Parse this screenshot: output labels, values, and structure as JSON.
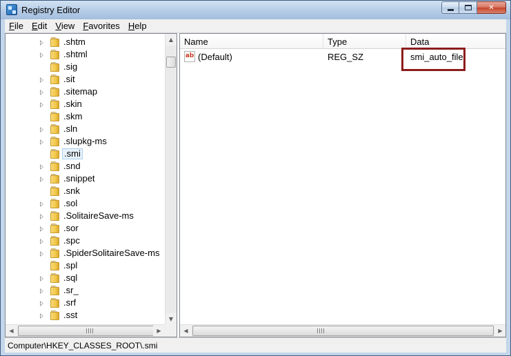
{
  "window": {
    "title": "Registry Editor"
  },
  "menubar": {
    "items": [
      {
        "first": "F",
        "rest": "ile"
      },
      {
        "first": "E",
        "rest": "dit"
      },
      {
        "first": "V",
        "rest": "iew"
      },
      {
        "first": "F",
        "rest": "avorites"
      },
      {
        "first": "H",
        "rest": "elp"
      }
    ]
  },
  "tree": {
    "items": [
      {
        "label": ".shtm",
        "expandable": true
      },
      {
        "label": ".shtml",
        "expandable": true
      },
      {
        "label": ".sig",
        "expandable": false
      },
      {
        "label": ".sit",
        "expandable": true
      },
      {
        "label": ".sitemap",
        "expandable": true
      },
      {
        "label": ".skin",
        "expandable": true
      },
      {
        "label": ".skm",
        "expandable": false
      },
      {
        "label": ".sln",
        "expandable": true
      },
      {
        "label": ".slupkg-ms",
        "expandable": true
      },
      {
        "label": ".smi",
        "expandable": false,
        "selected": true
      },
      {
        "label": ".snd",
        "expandable": true
      },
      {
        "label": ".snippet",
        "expandable": true
      },
      {
        "label": ".snk",
        "expandable": false
      },
      {
        "label": ".sol",
        "expandable": true
      },
      {
        "label": ".SolitaireSave-ms",
        "expandable": true
      },
      {
        "label": ".sor",
        "expandable": true
      },
      {
        "label": ".spc",
        "expandable": true
      },
      {
        "label": ".SpiderSolitaireSave-ms",
        "expandable": true
      },
      {
        "label": ".spl",
        "expandable": false
      },
      {
        "label": ".sql",
        "expandable": true
      },
      {
        "label": ".sr_",
        "expandable": true
      },
      {
        "label": ".srf",
        "expandable": true
      },
      {
        "label": ".sst",
        "expandable": true
      }
    ]
  },
  "list": {
    "columns": {
      "name": "Name",
      "type": "Type",
      "data": "Data"
    },
    "rows": [
      {
        "icon": "ab",
        "name": "(Default)",
        "type": "REG_SZ",
        "data": "smi_auto_file"
      }
    ]
  },
  "statusbar": {
    "path": "Computer\\HKEY_CLASSES_ROOT\\.smi"
  },
  "colors": {
    "highlight_box": "#8c1c1c",
    "folder": "#f2c84b"
  }
}
